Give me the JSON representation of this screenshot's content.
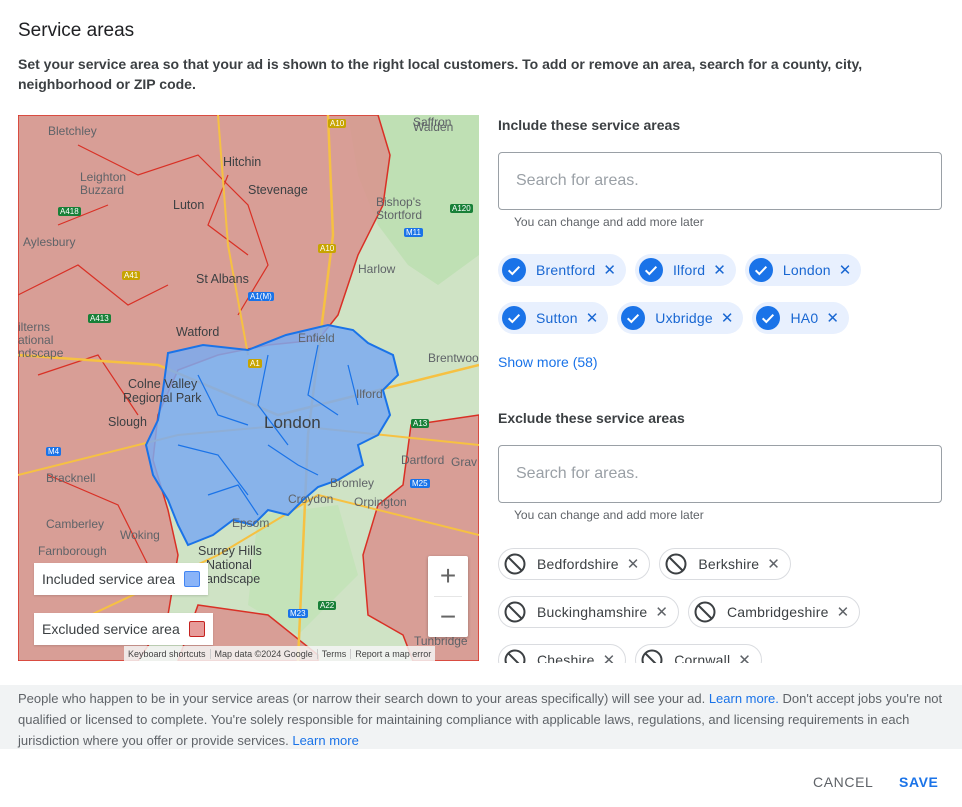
{
  "header": {
    "title": "Service areas",
    "subtitle": "Set your service area so that your ad is shown to the right local customers. To add or remove an area, search for a county, city, neighborhood or ZIP code."
  },
  "map": {
    "labels": {
      "bletchley": "Bletchley",
      "walden": "Walden",
      "saffron": "Saffron",
      "leighton": "Leighton",
      "buzzard": "Buzzard",
      "hitchin": "Hitchin",
      "stevenage": "Stevenage",
      "luton": "Luton",
      "bishops": "Bishop's",
      "stortford": "Stortford",
      "aylesbury": "Aylesbury",
      "harlow": "Harlow",
      "stalbans": "St Albans",
      "chilterns1": "ilterns",
      "chilterns2": "ational",
      "chilterns3": "ndscape",
      "watford": "Watford",
      "enfield": "Enfield",
      "brentwood": "Brentwoo",
      "colne1": "Colne Valley",
      "colne2": "Regional Park",
      "ilford": "Ilford",
      "slough": "Slough",
      "london": "London",
      "dartford": "Dartford",
      "grays": "Grav",
      "bracknell": "Bracknell",
      "bromley": "Bromley",
      "orpington": "Orpington",
      "croydon": "Croydon",
      "camberley": "Camberley",
      "woking": "Woking",
      "epsom": "Epsom",
      "farnborough": "Farnborough",
      "surrey1": "Surrey Hills",
      "surrey2": "National",
      "surrey3": "andscape",
      "tunbridge": "Tunbridge"
    },
    "shields": {
      "a10": "A10",
      "a10b": "A10",
      "a418": "A418",
      "a120": "A120",
      "m11": "M11",
      "a41": "A41",
      "a1m": "A1(M)",
      "a413": "A413",
      "a13": "A13",
      "a1": "A1",
      "m4": "M4",
      "m25": "M25",
      "m23": "M23",
      "a22": "A22"
    },
    "legend": {
      "included": "Included service area",
      "excluded": "Excluded service area"
    },
    "zoom_in": "+",
    "zoom_out": "−",
    "attribution": [
      "Keyboard shortcuts",
      "Map data ©2024 Google",
      "Terms",
      "Report a map error"
    ],
    "colors": {
      "included_fill": "#8ab4f8",
      "included_stroke": "#1a73e8",
      "excluded_fill": "#e59a96",
      "excluded_stroke": "#d93025"
    }
  },
  "include": {
    "title": "Include these service areas",
    "placeholder": "Search for areas.",
    "hint": "You can change and add more later",
    "chips": [
      "Brentford",
      "Ilford",
      "London",
      "Sutton",
      "Uxbridge",
      "HA0"
    ],
    "show_more": "Show more (58)"
  },
  "exclude": {
    "title": "Exclude these service areas",
    "placeholder": "Search for areas.",
    "hint": "You can change and add more later",
    "chips": [
      "Bedfordshire",
      "Berkshire",
      "Buckinghamshire",
      "Cambridgeshire",
      "Cheshire",
      "Cornwall"
    ]
  },
  "notice": {
    "text1": "People who happen to be in your service areas (or narrow their search down to your areas specifically) will see your ad.",
    "link1": "Learn more.",
    "text2": "Don't accept jobs you're not qualified or licensed to complete. You're solely responsible for maintaining compliance with applicable laws, regulations, and licensing requirements in each jurisdiction where you offer or provide services.",
    "link2": "Learn more"
  },
  "footer": {
    "cancel": "CANCEL",
    "save": "SAVE"
  },
  "icons": {
    "check": "check-icon",
    "close": "close-icon",
    "block": "block-icon"
  }
}
